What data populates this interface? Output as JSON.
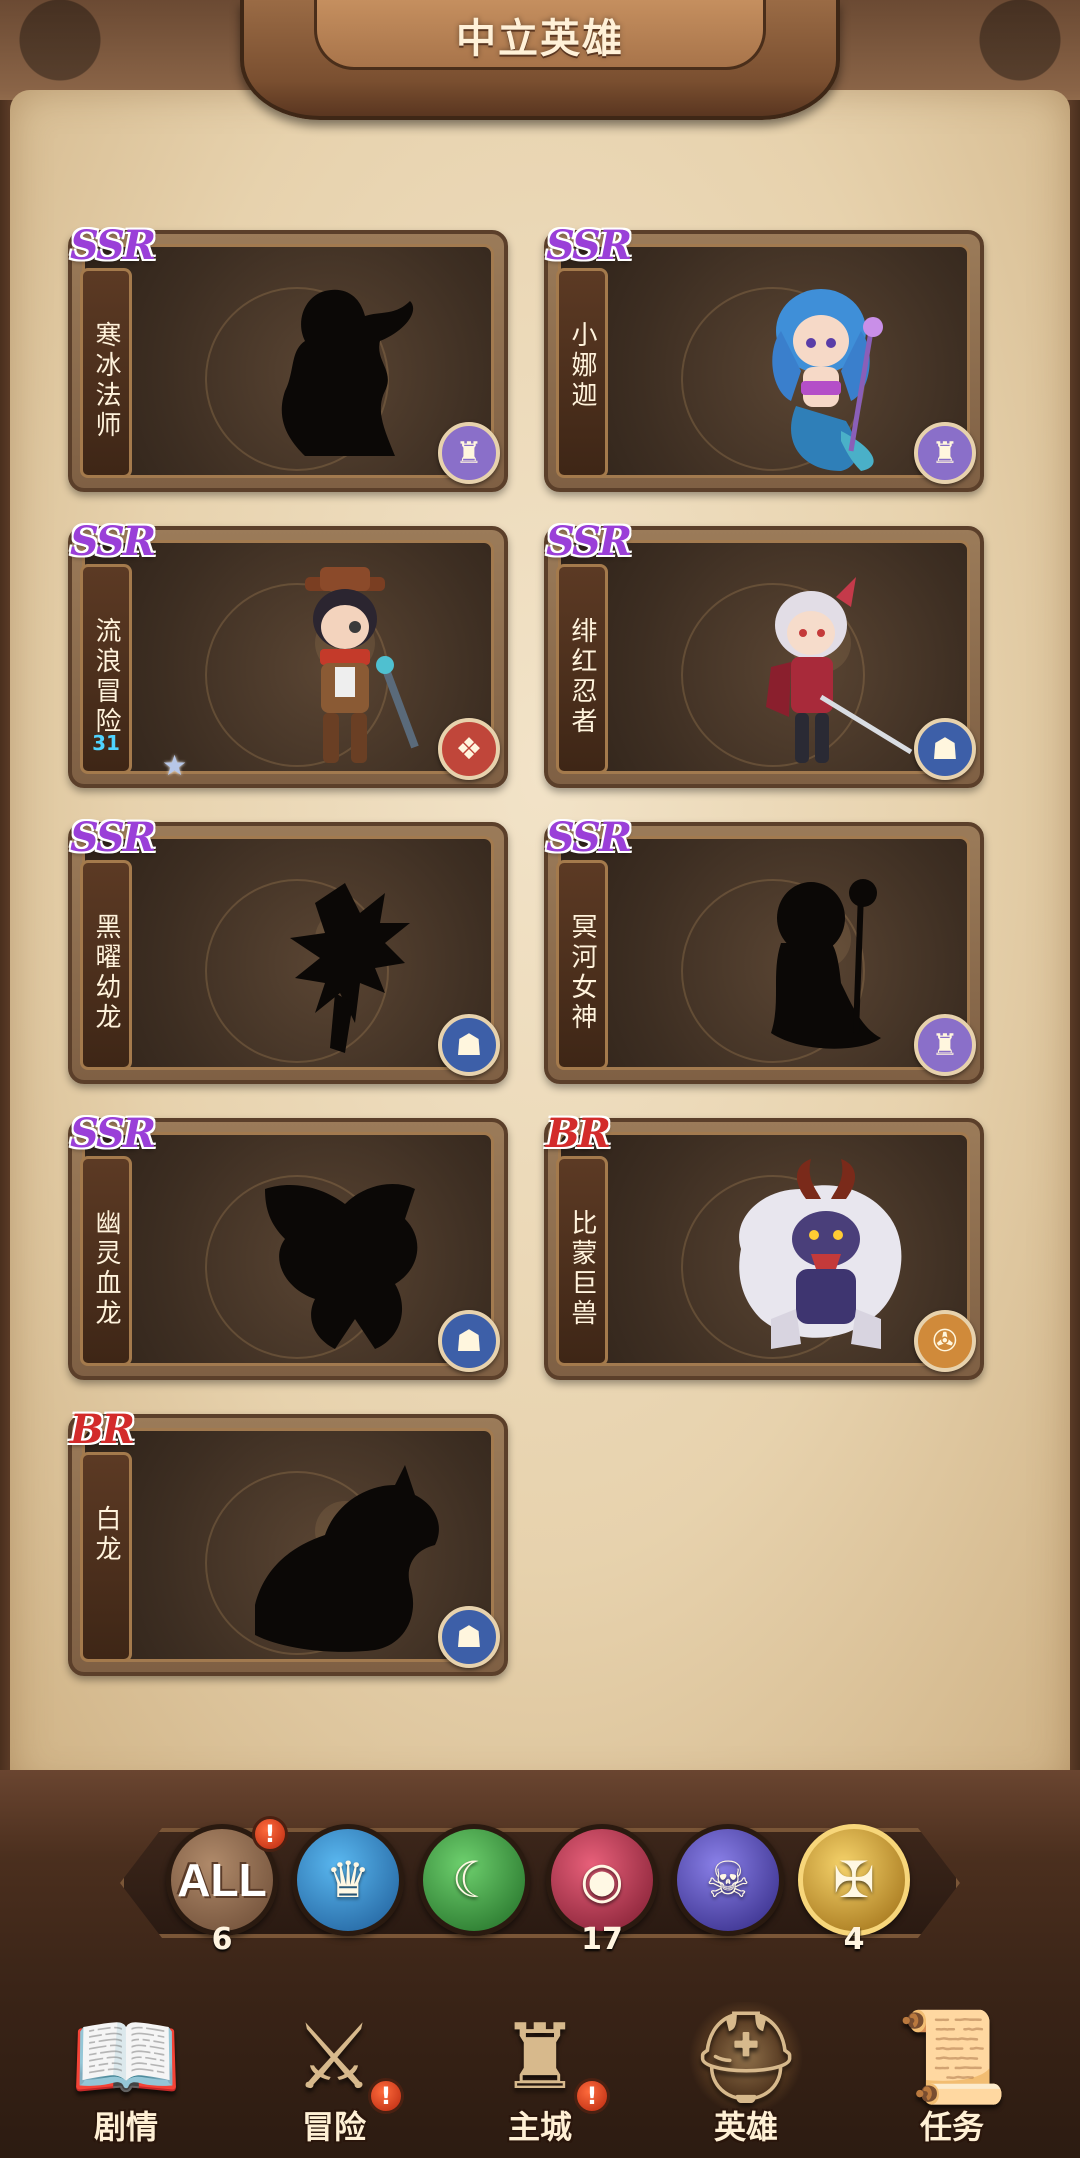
{
  "header": {
    "title": "中立英雄"
  },
  "heroes": [
    {
      "rarity": "SSR",
      "name": "寒冰法师",
      "level": "",
      "locked": true,
      "faction_icon": "helmet-icon",
      "faction_color": "#8a6fc9"
    },
    {
      "rarity": "SSR",
      "name": "小娜迦",
      "level": "",
      "locked": false,
      "faction_icon": "helmet-icon",
      "faction_color": "#8a6fc9"
    },
    {
      "rarity": "SSR",
      "name": "流浪冒险",
      "level": "31",
      "locked": false,
      "faction_icon": "scroll-icon",
      "faction_color": "#c0463a",
      "stars": "★"
    },
    {
      "rarity": "SSR",
      "name": "绯红忍者",
      "level": "",
      "locked": false,
      "faction_icon": "hood-icon",
      "faction_color": "#3d5fa8"
    },
    {
      "rarity": "SSR",
      "name": "黑曜幼龙",
      "level": "",
      "locked": true,
      "faction_icon": "hood-icon",
      "faction_color": "#3d5fa8"
    },
    {
      "rarity": "SSR",
      "name": "冥河女神",
      "level": "",
      "locked": true,
      "faction_icon": "helmet-icon",
      "faction_color": "#8a6fc9"
    },
    {
      "rarity": "SSR",
      "name": "幽灵血龙",
      "level": "",
      "locked": true,
      "faction_icon": "hood-icon",
      "faction_color": "#3d5fa8"
    },
    {
      "rarity": "BR",
      "name": "比蒙巨兽",
      "level": "",
      "locked": false,
      "faction_icon": "cannon-icon",
      "faction_color": "#d08a3a"
    },
    {
      "rarity": "BR",
      "name": "白龙",
      "level": "",
      "locked": true,
      "faction_icon": "hood-icon",
      "faction_color": "#3d5fa8"
    }
  ],
  "filters": [
    {
      "id": "all",
      "label": "ALL",
      "count": "6",
      "alert": "!",
      "color": "#8a6a52"
    },
    {
      "id": "crown",
      "label": "",
      "count": "",
      "glyph": "♛",
      "color": "#2f86c9"
    },
    {
      "id": "moon",
      "label": "",
      "count": "",
      "glyph": "☾",
      "color": "#3a9a3a"
    },
    {
      "id": "eye",
      "label": "",
      "count": "17",
      "glyph": "◉",
      "color": "#b8324a"
    },
    {
      "id": "skull",
      "label": "",
      "count": "",
      "glyph": "☠",
      "color": "#5a4fb8"
    },
    {
      "id": "wings",
      "label": "",
      "count": "4",
      "glyph": "✠",
      "color": "#d8a52a"
    }
  ],
  "nav": [
    {
      "label": "剧情",
      "glyph": "📖",
      "alert": ""
    },
    {
      "label": "冒险",
      "glyph": "⚔",
      "alert": "!"
    },
    {
      "label": "主城",
      "glyph": "♜",
      "alert": "!"
    },
    {
      "label": "英雄",
      "glyph": "⛑",
      "alert": "",
      "active": true
    },
    {
      "label": "任务",
      "glyph": "📜",
      "alert": ""
    }
  ]
}
